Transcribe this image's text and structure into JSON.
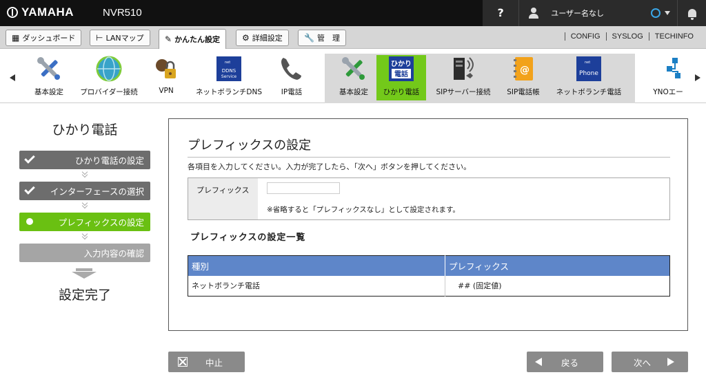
{
  "header": {
    "logo": "YAMAHA",
    "model": "NVR510",
    "help": "?",
    "user": "ユーザー名なし"
  },
  "tabs": [
    {
      "label": "ダッシュボード",
      "icon": "dashboard-icon"
    },
    {
      "label": "LANマップ",
      "icon": "lan-map-icon"
    },
    {
      "label": "かんたん設定",
      "icon": "wizard-icon",
      "active": true
    },
    {
      "label": "詳細設定",
      "icon": "gear-icon"
    },
    {
      "label": "管　理",
      "icon": "wrench-icon"
    }
  ],
  "toplinks": [
    "CONFIG",
    "SYSLOG",
    "TECHINFO"
  ],
  "features": [
    {
      "label": "基本設定",
      "icon": "tools-icon"
    },
    {
      "label": "プロバイダー接続",
      "icon": "globe-icon"
    },
    {
      "label": "VPN",
      "icon": "vpn-lock-icon"
    },
    {
      "label": "ネットボランチDNS",
      "icon": "ddns-icon",
      "badge": "DDNS Service"
    },
    {
      "label": "IP電話",
      "icon": "phone-handset-icon"
    },
    {
      "label": "基本設定",
      "icon": "tools-icon"
    },
    {
      "label": "ひかり電話",
      "icon": "hikari-denwa-icon",
      "badge_top": "ひかり",
      "badge_bottom": "電話",
      "selected": true
    },
    {
      "label": "SIPサーバー接続",
      "icon": "sip-server-icon"
    },
    {
      "label": "SIP電話帳",
      "icon": "phonebook-icon"
    },
    {
      "label": "ネットボランチ電話",
      "icon": "netvolante-phone-icon",
      "badge": "Phone"
    },
    {
      "label": "YNOエー",
      "icon": "yno-icon"
    }
  ],
  "wizard": {
    "title": "ひかり電話",
    "steps": [
      {
        "label": "ひかり電話の設定",
        "state": "done"
      },
      {
        "label": "インターフェースの選択",
        "state": "done"
      },
      {
        "label": "プレフィックスの設定",
        "state": "current"
      },
      {
        "label": "入力内容の確認",
        "state": "todo"
      }
    ],
    "end": "設定完了"
  },
  "main": {
    "title": "プレフィックスの設定",
    "instruction": "各項目を入力してください。入力が完了したら、「次へ」ボタンを押してください。",
    "field_label": "プレフィックス",
    "field_value": "",
    "field_note": "※省略すると「プレフィックスなし」として設定されます。",
    "list_title": "プレフィックスの設定一覧",
    "table": {
      "headers": [
        "種別",
        "プレフィックス"
      ],
      "rows": [
        [
          "ネットボランチ電話",
          "## (固定値)"
        ]
      ]
    }
  },
  "buttons": {
    "cancel": "中止",
    "back": "戻る",
    "next": "次へ"
  },
  "colors": {
    "accent_green": "#6ac012",
    "table_header": "#5e86c9",
    "header_bg": "#111111"
  }
}
